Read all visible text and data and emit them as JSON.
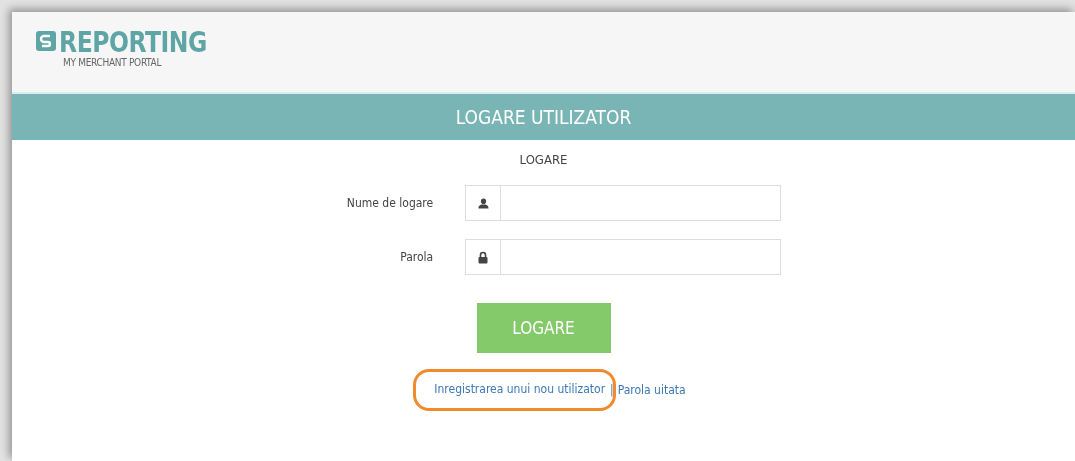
{
  "header": {
    "logo_title": "REPORTING",
    "logo_subtitle": "MY MERCHANT PORTAL"
  },
  "title_bar": {
    "title": "LOGARE UTILIZATOR"
  },
  "form": {
    "heading": "LOGARE",
    "fields": [
      {
        "label": "Nume de logare",
        "kind": "user"
      },
      {
        "label": "Parola",
        "kind": "password"
      }
    ],
    "submit": "LOGARE"
  },
  "links": [
    {
      "label": "Inregistrarea unui nou utilizator",
      "highlighted": true
    },
    {
      "label": "Parola uitata",
      "highlighted": false
    }
  ],
  "link_separator": "|"
}
